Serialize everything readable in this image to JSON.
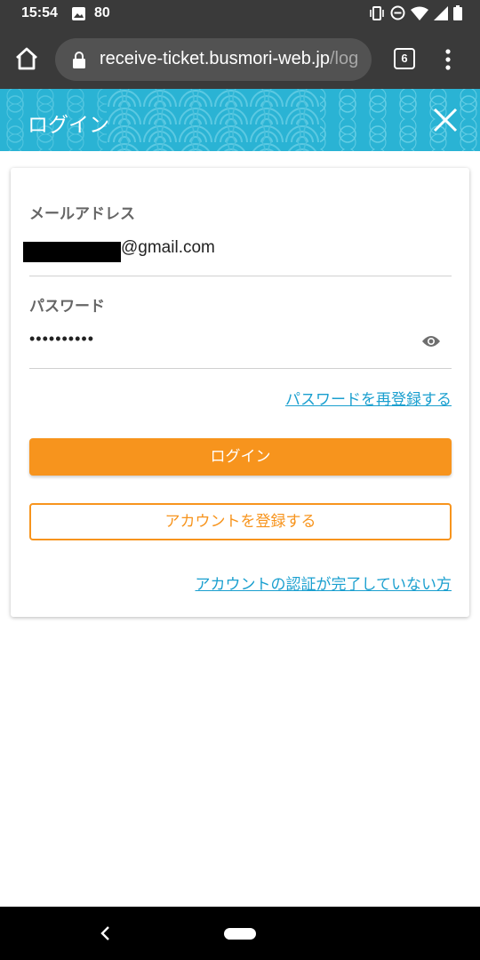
{
  "status_bar": {
    "time": "15:54",
    "battery_level": "80",
    "icons": [
      "gallery-icon",
      "vibrate-icon",
      "dnd-icon",
      "wifi-icon",
      "signal-icon",
      "battery-icon"
    ]
  },
  "browser": {
    "url_domain": "receive-ticket.busmori-web.jp",
    "url_path": "/log",
    "tab_count": "6"
  },
  "header": {
    "title": "ログイン",
    "color": "#2ab3d4"
  },
  "form": {
    "email_label": "メールアドレス",
    "email_value": "@gmail.com",
    "password_label": "パスワード",
    "password_value": "••••••••••",
    "reset_link": "パスワードを再登録する",
    "login_button": "ログイン",
    "register_button": "アカウントを登録する",
    "unverified_link": "アカウントの認証が完了していない方"
  },
  "colors": {
    "accent": "#f7941d",
    "link": "#1a9fcf"
  }
}
